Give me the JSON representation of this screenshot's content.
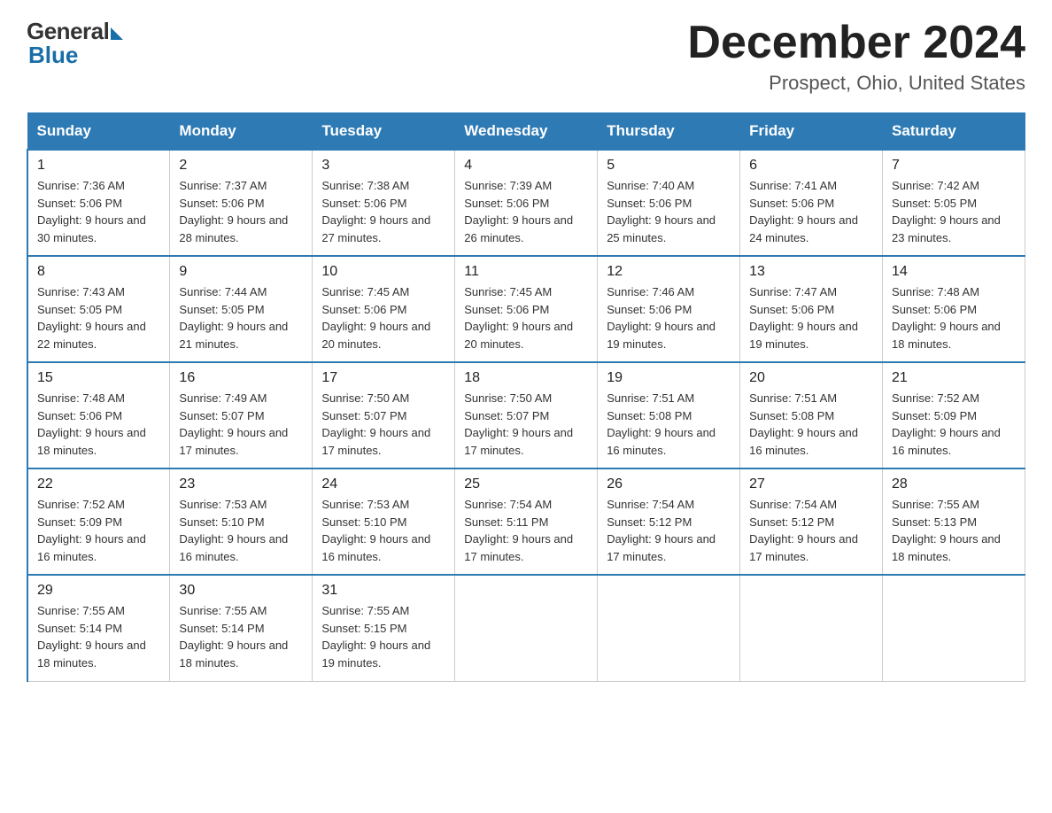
{
  "header": {
    "logo_general": "General",
    "logo_blue": "Blue",
    "title": "December 2024",
    "subtitle": "Prospect, Ohio, United States"
  },
  "days_of_week": [
    "Sunday",
    "Monday",
    "Tuesday",
    "Wednesday",
    "Thursday",
    "Friday",
    "Saturday"
  ],
  "weeks": [
    [
      {
        "day": "1",
        "sunrise": "7:36 AM",
        "sunset": "5:06 PM",
        "daylight": "9 hours and 30 minutes."
      },
      {
        "day": "2",
        "sunrise": "7:37 AM",
        "sunset": "5:06 PM",
        "daylight": "9 hours and 28 minutes."
      },
      {
        "day": "3",
        "sunrise": "7:38 AM",
        "sunset": "5:06 PM",
        "daylight": "9 hours and 27 minutes."
      },
      {
        "day": "4",
        "sunrise": "7:39 AM",
        "sunset": "5:06 PM",
        "daylight": "9 hours and 26 minutes."
      },
      {
        "day": "5",
        "sunrise": "7:40 AM",
        "sunset": "5:06 PM",
        "daylight": "9 hours and 25 minutes."
      },
      {
        "day": "6",
        "sunrise": "7:41 AM",
        "sunset": "5:06 PM",
        "daylight": "9 hours and 24 minutes."
      },
      {
        "day": "7",
        "sunrise": "7:42 AM",
        "sunset": "5:05 PM",
        "daylight": "9 hours and 23 minutes."
      }
    ],
    [
      {
        "day": "8",
        "sunrise": "7:43 AM",
        "sunset": "5:05 PM",
        "daylight": "9 hours and 22 minutes."
      },
      {
        "day": "9",
        "sunrise": "7:44 AM",
        "sunset": "5:05 PM",
        "daylight": "9 hours and 21 minutes."
      },
      {
        "day": "10",
        "sunrise": "7:45 AM",
        "sunset": "5:06 PM",
        "daylight": "9 hours and 20 minutes."
      },
      {
        "day": "11",
        "sunrise": "7:45 AM",
        "sunset": "5:06 PM",
        "daylight": "9 hours and 20 minutes."
      },
      {
        "day": "12",
        "sunrise": "7:46 AM",
        "sunset": "5:06 PM",
        "daylight": "9 hours and 19 minutes."
      },
      {
        "day": "13",
        "sunrise": "7:47 AM",
        "sunset": "5:06 PM",
        "daylight": "9 hours and 19 minutes."
      },
      {
        "day": "14",
        "sunrise": "7:48 AM",
        "sunset": "5:06 PM",
        "daylight": "9 hours and 18 minutes."
      }
    ],
    [
      {
        "day": "15",
        "sunrise": "7:48 AM",
        "sunset": "5:06 PM",
        "daylight": "9 hours and 18 minutes."
      },
      {
        "day": "16",
        "sunrise": "7:49 AM",
        "sunset": "5:07 PM",
        "daylight": "9 hours and 17 minutes."
      },
      {
        "day": "17",
        "sunrise": "7:50 AM",
        "sunset": "5:07 PM",
        "daylight": "9 hours and 17 minutes."
      },
      {
        "day": "18",
        "sunrise": "7:50 AM",
        "sunset": "5:07 PM",
        "daylight": "9 hours and 17 minutes."
      },
      {
        "day": "19",
        "sunrise": "7:51 AM",
        "sunset": "5:08 PM",
        "daylight": "9 hours and 16 minutes."
      },
      {
        "day": "20",
        "sunrise": "7:51 AM",
        "sunset": "5:08 PM",
        "daylight": "9 hours and 16 minutes."
      },
      {
        "day": "21",
        "sunrise": "7:52 AM",
        "sunset": "5:09 PM",
        "daylight": "9 hours and 16 minutes."
      }
    ],
    [
      {
        "day": "22",
        "sunrise": "7:52 AM",
        "sunset": "5:09 PM",
        "daylight": "9 hours and 16 minutes."
      },
      {
        "day": "23",
        "sunrise": "7:53 AM",
        "sunset": "5:10 PM",
        "daylight": "9 hours and 16 minutes."
      },
      {
        "day": "24",
        "sunrise": "7:53 AM",
        "sunset": "5:10 PM",
        "daylight": "9 hours and 16 minutes."
      },
      {
        "day": "25",
        "sunrise": "7:54 AM",
        "sunset": "5:11 PM",
        "daylight": "9 hours and 17 minutes."
      },
      {
        "day": "26",
        "sunrise": "7:54 AM",
        "sunset": "5:12 PM",
        "daylight": "9 hours and 17 minutes."
      },
      {
        "day": "27",
        "sunrise": "7:54 AM",
        "sunset": "5:12 PM",
        "daylight": "9 hours and 17 minutes."
      },
      {
        "day": "28",
        "sunrise": "7:55 AM",
        "sunset": "5:13 PM",
        "daylight": "9 hours and 18 minutes."
      }
    ],
    [
      {
        "day": "29",
        "sunrise": "7:55 AM",
        "sunset": "5:14 PM",
        "daylight": "9 hours and 18 minutes."
      },
      {
        "day": "30",
        "sunrise": "7:55 AM",
        "sunset": "5:14 PM",
        "daylight": "9 hours and 18 minutes."
      },
      {
        "day": "31",
        "sunrise": "7:55 AM",
        "sunset": "5:15 PM",
        "daylight": "9 hours and 19 minutes."
      },
      null,
      null,
      null,
      null
    ]
  ]
}
